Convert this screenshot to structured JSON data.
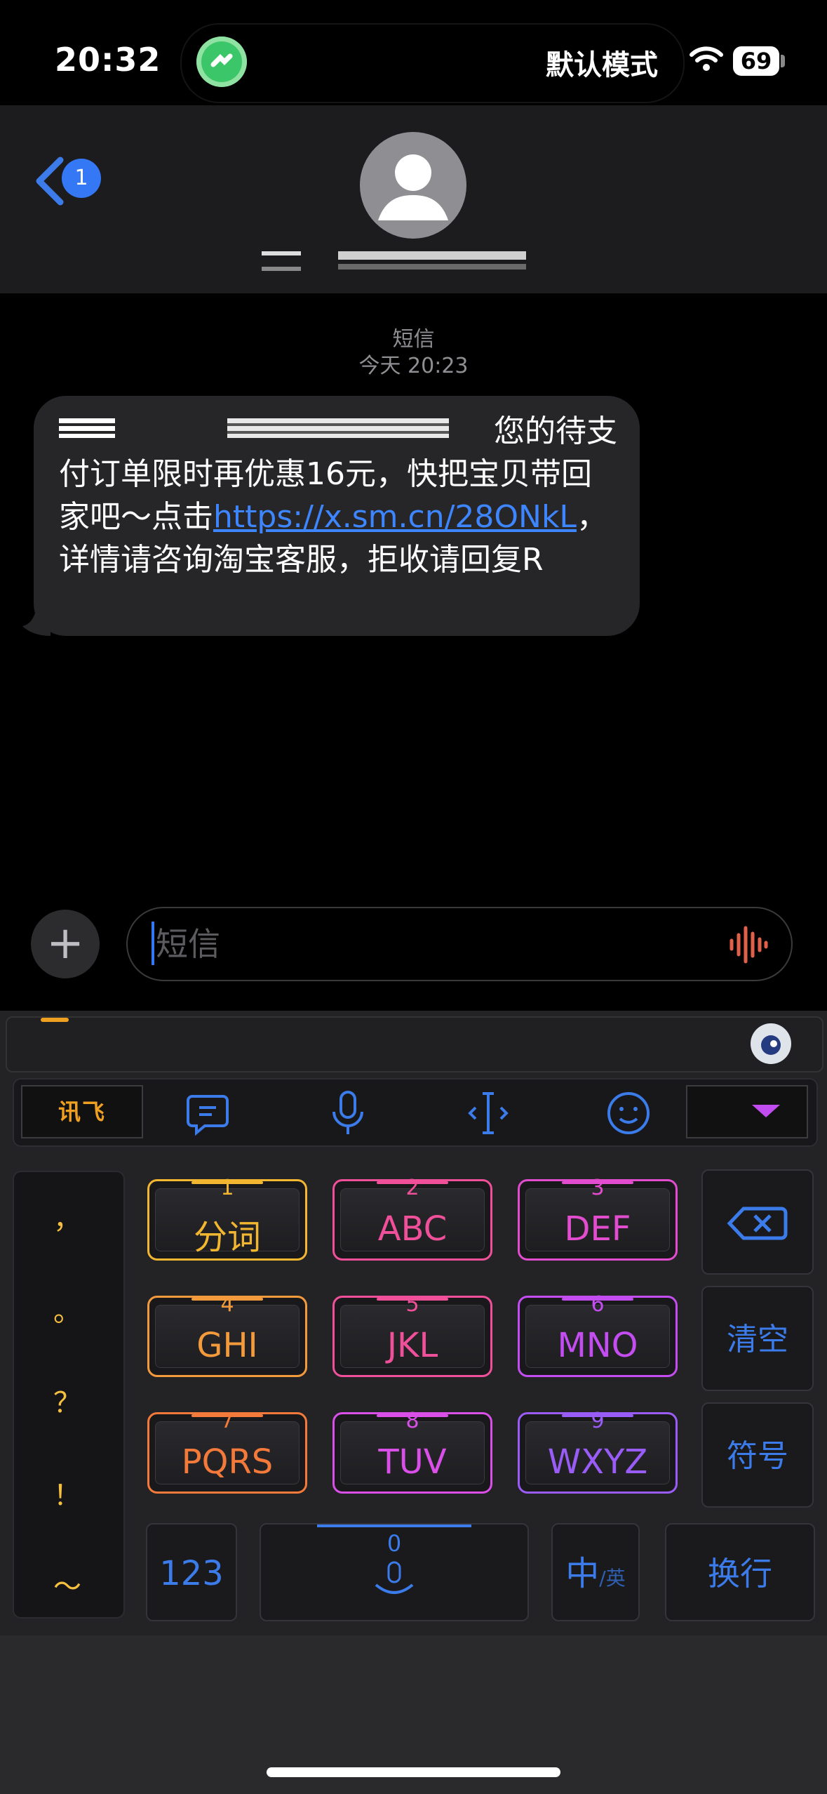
{
  "status": {
    "time": "20:32",
    "focus_mode": "默认模式",
    "battery": "69"
  },
  "header": {
    "back_badge": "1"
  },
  "conversation": {
    "service": "短信",
    "timestamp": "今天 20:23",
    "message": {
      "line1_tail": "您的待",
      "body_before_link": "支付订单限时再优惠16元，快把宝贝带回家吧～点击",
      "link": "https://x.sm.cn/28ONkL",
      "body_after_link": "，详情请咨询淘宝客服，拒收请回复R"
    }
  },
  "composer": {
    "placeholder": "短信"
  },
  "keyboard": {
    "logo": "讯飞",
    "punctuation": [
      "，",
      "。",
      "？",
      "！",
      "～"
    ],
    "keys": [
      {
        "num": "1",
        "label": "分词",
        "color": "#f2b630"
      },
      {
        "num": "2",
        "label": "ABC",
        "color": "#f0509a"
      },
      {
        "num": "3",
        "label": "DEF",
        "color": "#e24ccf"
      },
      {
        "num": "4",
        "label": "GHI",
        "color": "#f39a3c"
      },
      {
        "num": "5",
        "label": "JKL",
        "color": "#f0509a"
      },
      {
        "num": "6",
        "label": "MNO",
        "color": "#c34df0"
      },
      {
        "num": "7",
        "label": "PQRS",
        "color": "#f37a3a"
      },
      {
        "num": "8",
        "label": "TUV",
        "color": "#d94fe8"
      },
      {
        "num": "9",
        "label": "WXYZ",
        "color": "#9a5cf6"
      }
    ],
    "side_keys": {
      "clear": "清空",
      "symbols": "符号"
    },
    "bottom": {
      "numbers": "123",
      "space_num": "0",
      "lang_main": "中",
      "lang_alt": "/英",
      "enter": "换行"
    },
    "accent": "#3b7bea"
  }
}
